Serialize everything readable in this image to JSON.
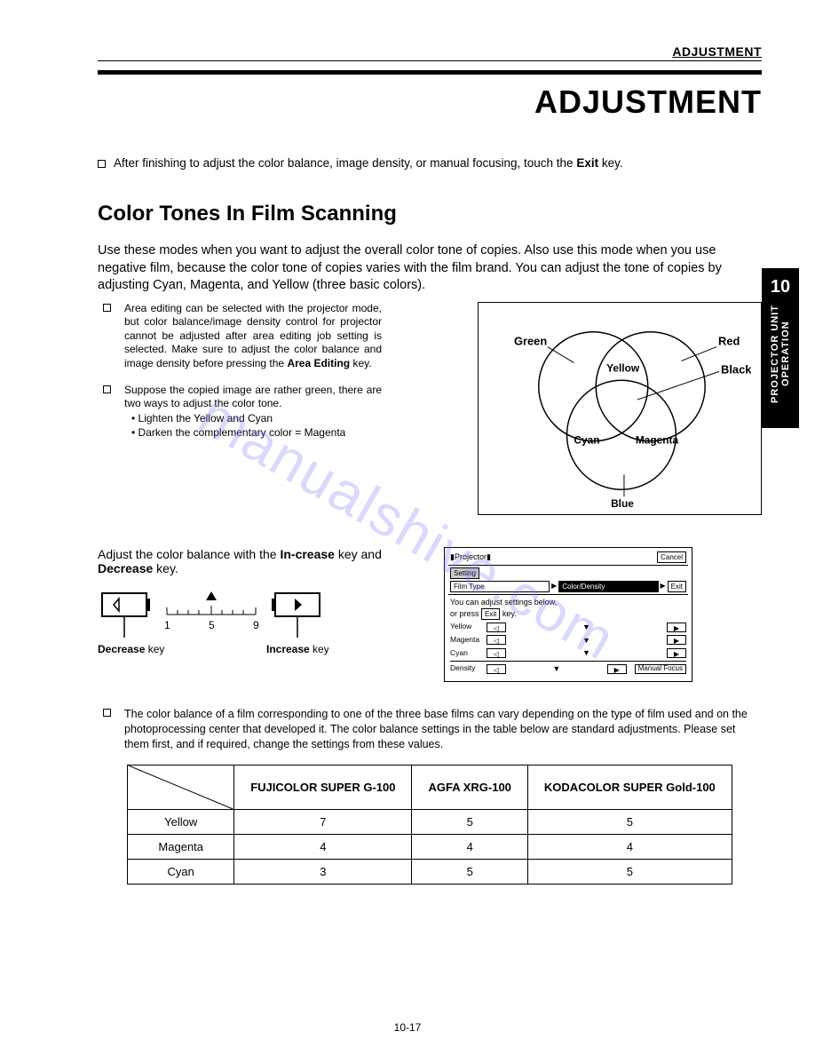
{
  "header": {
    "label": "ADJUSTMENT"
  },
  "title": "ADJUSTMENT",
  "intro": {
    "prefix": "After finishing to adjust the color balance, image density, or manual focusing, touch the ",
    "bold": "Exit",
    "suffix": " key."
  },
  "section_heading": "Color Tones In Film Scanning",
  "paragraph": "Use these modes when you want to adjust the overall color tone of copies. Also use this mode when you use negative film, because the color tone of copies varies with the film brand. You can adjust the tone of copies by adjusting Cyan, Magenta, and Yellow (three basic colors).",
  "note1": {
    "text_a": "Area editing can be selected with the projector mode, but color balance/image density control for projector cannot be adjusted after area editing job setting is selected. Make sure to adjust the color balance and image density before pressing the ",
    "bold": "Area Editing",
    "text_b": " key."
  },
  "note2": {
    "lead": "Suppose the copied image are rather green, there are two ways to adjust the color tone.",
    "b1": "Lighten the Yellow and Cyan",
    "b2": "Darken the complementary color = Magenta"
  },
  "venn": {
    "green": "Green",
    "red": "Red",
    "black": "Black",
    "yellow": "Yellow",
    "cyan": "Cyan",
    "magenta": "Magenta",
    "blue": "Blue"
  },
  "side_tab": {
    "num": "10",
    "line1": "PROJECTOR UNIT",
    "line2": "OPERATION"
  },
  "adjust": {
    "text_a": "Adjust the color balance with the ",
    "bold1": "In-crease",
    "mid": " key and ",
    "bold2": "Decrease",
    "text_b": " key.",
    "decrease_label": "Decrease",
    "increase_label": "Increase",
    "key_word": " key",
    "scale": {
      "n1": "1",
      "n5": "5",
      "n9": "9"
    }
  },
  "lcd": {
    "title": "Projector",
    "cancel": "Cancel",
    "setting": "Setting",
    "filmtype": "Film Type",
    "colordensity": "Color/Density",
    "exit": "Exit",
    "help1": "You can adjust settings below,",
    "help2_a": "or press ",
    "help2_b": " key.",
    "exit_inline": "Exit",
    "rows": {
      "yellow": "Yellow",
      "magenta": "Magenta",
      "cyan": "Cyan",
      "density": "Density"
    },
    "manual_focus": "Manual Focus"
  },
  "big_note": "The color balance of a film corresponding to one of the three base films can vary depending on the type of film used and on the photoprocessing center that developed it. The color balance settings in the table below are standard adjustments. Please set them first, and if required, change the settings from these values.",
  "table": {
    "headers": [
      "FUJICOLOR SUPER G-100",
      "AGFA XRG-100",
      "KODACOLOR SUPER Gold-100"
    ],
    "rows": [
      {
        "label": "Yellow",
        "v": [
          "7",
          "5",
          "5"
        ]
      },
      {
        "label": "Magenta",
        "v": [
          "4",
          "4",
          "4"
        ]
      },
      {
        "label": "Cyan",
        "v": [
          "3",
          "5",
          "5"
        ]
      }
    ]
  },
  "page_number": "10-17",
  "watermark": "manualshive.com"
}
